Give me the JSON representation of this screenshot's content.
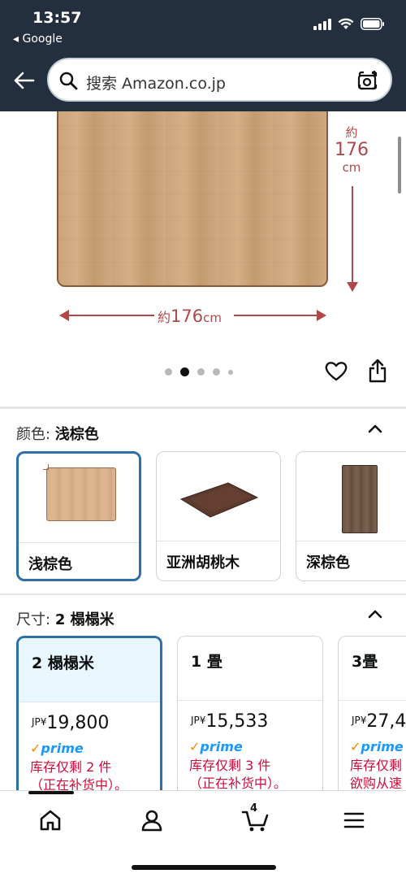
{
  "status_bar": {
    "time": "13:57",
    "back_app": "◂ Google"
  },
  "search": {
    "placeholder": "搜索 Amazon.co.jp"
  },
  "product_image": {
    "height_dim": {
      "prefix": "約",
      "value": "176",
      "unit": "cm"
    },
    "width_dim": {
      "prefix": "約",
      "value": "176",
      "unit": "cm"
    },
    "carousel": {
      "total": 5,
      "active_index": 1
    }
  },
  "color_section": {
    "label": "颜色:",
    "selected_value": "浅棕色",
    "options": [
      {
        "name": "浅棕色",
        "selected": true
      },
      {
        "name": "亚洲胡桃木",
        "selected": false
      },
      {
        "name": "深棕色",
        "selected": false
      }
    ]
  },
  "size_section": {
    "label": "尺寸:",
    "selected_value": "2 榻榻米",
    "options": [
      {
        "title": "2 榻榻米",
        "currency": "JP¥",
        "price": "19,800",
        "prime": "prime",
        "stock_line1": "库存仅剩 2 件",
        "stock_line2": "（正在补货中）。",
        "selected": true
      },
      {
        "title": "1 畳",
        "currency": "JP¥",
        "price": "15,533",
        "prime": "prime",
        "stock_line1": "库存仅剩 3 件",
        "stock_line2": "（正在补货中）。",
        "selected": false
      },
      {
        "title": "3畳",
        "currency": "JP¥",
        "price": "27,4",
        "prime": "prime",
        "stock_line1": "库存仅剩",
        "stock_line2": "欲购从速",
        "selected": false
      }
    ]
  },
  "bottom_nav": {
    "cart_count": "4"
  },
  "colors": {
    "header_bg": "#232f3e",
    "selected_border": "#2f6fa8",
    "prime_blue": "#1a98ff",
    "stock_red": "#cc0c39",
    "dimension_red": "#b0484a"
  }
}
